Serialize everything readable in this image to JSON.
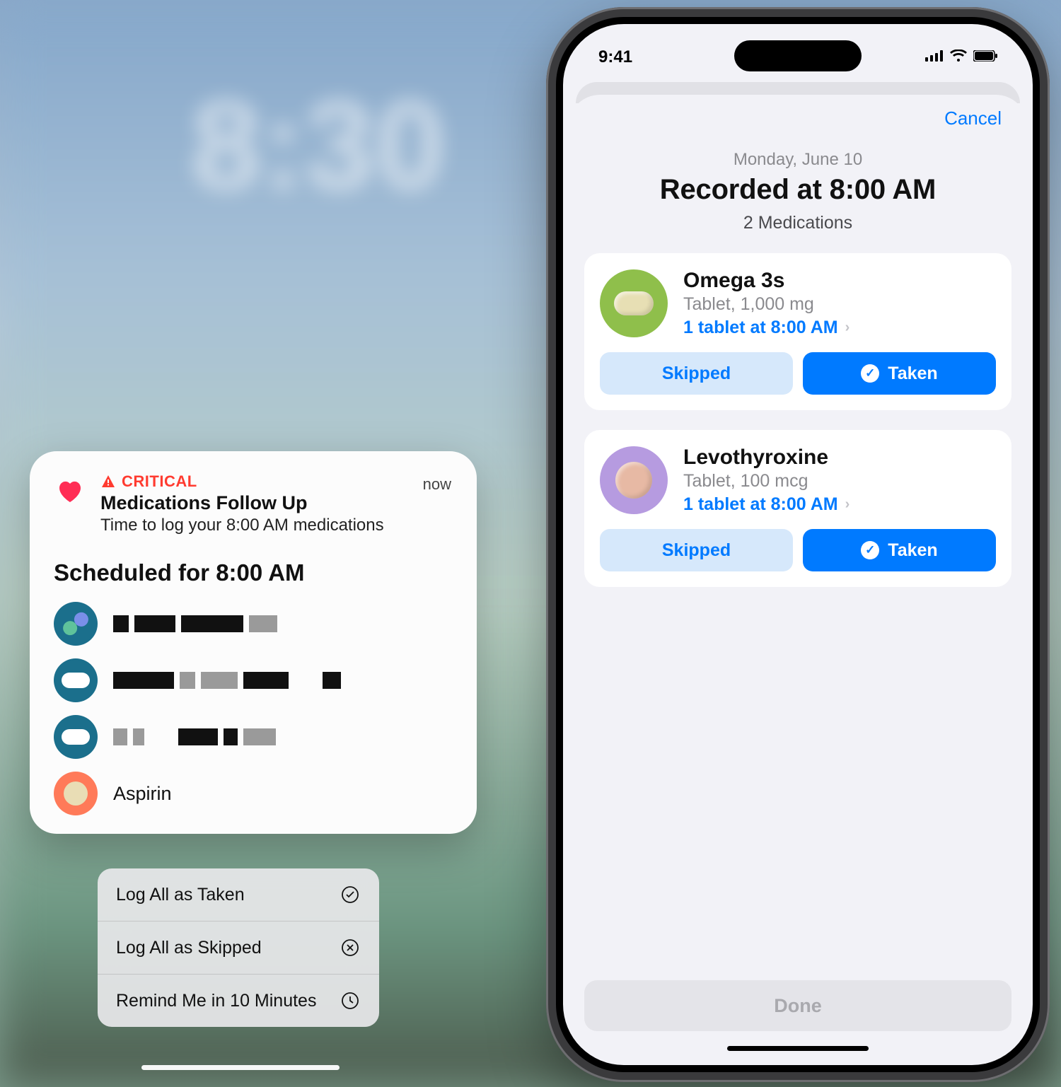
{
  "lockscreen": {
    "date": "",
    "time": "8:30"
  },
  "notification": {
    "critical_label": "CRITICAL",
    "title": "Medications Follow Up",
    "body": "Time to log your 8:00 AM medications",
    "timestamp": "now",
    "scheduled_title": "Scheduled for 8:00 AM",
    "meds": [
      {
        "name_redacted": true,
        "icon": "capsule-teal"
      },
      {
        "name_redacted": true,
        "icon": "tablet-teal"
      },
      {
        "name_redacted": true,
        "icon": "tablet-teal"
      },
      {
        "name": "Aspirin",
        "icon": "tablet-orange"
      }
    ]
  },
  "actions": {
    "items": [
      {
        "label": "Log All as Taken",
        "icon": "check-circle"
      },
      {
        "label": "Log All as Skipped",
        "icon": "x-circle"
      },
      {
        "label": "Remind Me in 10 Minutes",
        "icon": "clock"
      }
    ]
  },
  "phone": {
    "status_time": "9:41",
    "cancel": "Cancel",
    "header": {
      "date": "Monday, June 10",
      "title": "Recorded at 8:00 AM",
      "subtitle": "2 Medications"
    },
    "medications": [
      {
        "name": "Omega 3s",
        "dose": "Tablet, 1,000 mg",
        "schedule": "1 tablet at 8:00 AM",
        "icon": "green-pill",
        "skipped_label": "Skipped",
        "taken_label": "Taken"
      },
      {
        "name": "Levothyroxine",
        "dose": "Tablet, 100 mcg",
        "schedule": "1 tablet at 8:00 AM",
        "icon": "purple-pill",
        "skipped_label": "Skipped",
        "taken_label": "Taken"
      }
    ],
    "done": "Done"
  }
}
